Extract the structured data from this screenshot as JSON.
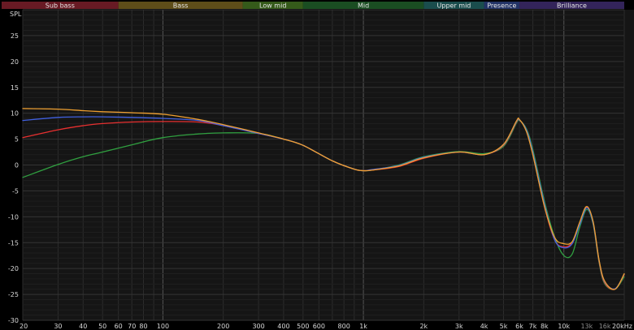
{
  "chart_data": {
    "type": "line",
    "ylabel": "SPL",
    "x_scale": "log",
    "xlim": [
      20,
      20000
    ],
    "ylim": [
      -30,
      30
    ],
    "grid": true,
    "bands": [
      {
        "label": "Sub bass",
        "from": 20,
        "to": 60,
        "color": "#7a1f2a"
      },
      {
        "label": "Bass",
        "from": 60,
        "to": 250,
        "color": "#6e5a1d"
      },
      {
        "label": "Low mid",
        "from": 250,
        "to": 500,
        "color": "#3e6a1f"
      },
      {
        "label": "Mid",
        "from": 500,
        "to": 2000,
        "color": "#1f5a28"
      },
      {
        "label": "Upper mid",
        "from": 2000,
        "to": 4000,
        "color": "#1f5a5a"
      },
      {
        "label": "Presence",
        "from": 4000,
        "to": 6000,
        "color": "#283c78"
      },
      {
        "label": "Brilliance",
        "from": 6000,
        "to": 20000,
        "color": "#3c2a6a"
      }
    ],
    "y_ticks": [
      25,
      20,
      15,
      10,
      5,
      0,
      -5,
      -10,
      -15,
      -20,
      -25,
      -30
    ],
    "x_ticks": [
      {
        "value": 20,
        "label": "20",
        "dim": false
      },
      {
        "value": 30,
        "label": "30",
        "dim": false
      },
      {
        "value": 40,
        "label": "40",
        "dim": false
      },
      {
        "value": 50,
        "label": "50",
        "dim": false
      },
      {
        "value": 60,
        "label": "60",
        "dim": false
      },
      {
        "value": 70,
        "label": "70",
        "dim": false
      },
      {
        "value": 80,
        "label": "80",
        "dim": false
      },
      {
        "value": 100,
        "label": "100",
        "dim": false
      },
      {
        "value": 200,
        "label": "200",
        "dim": false
      },
      {
        "value": 300,
        "label": "300",
        "dim": false
      },
      {
        "value": 400,
        "label": "400",
        "dim": false
      },
      {
        "value": 500,
        "label": "500",
        "dim": false
      },
      {
        "value": 600,
        "label": "600",
        "dim": false
      },
      {
        "value": 800,
        "label": "800",
        "dim": false
      },
      {
        "value": 1000,
        "label": "1k",
        "dim": false
      },
      {
        "value": 2000,
        "label": "2k",
        "dim": false
      },
      {
        "value": 3000,
        "label": "3k",
        "dim": false
      },
      {
        "value": 4000,
        "label": "4k",
        "dim": false
      },
      {
        "value": 5000,
        "label": "5k",
        "dim": false
      },
      {
        "value": 6000,
        "label": "6k",
        "dim": false
      },
      {
        "value": 7000,
        "label": "7k",
        "dim": false
      },
      {
        "value": 8000,
        "label": "8k",
        "dim": false
      },
      {
        "value": 10000,
        "label": "10k",
        "dim": false
      },
      {
        "value": 13000,
        "label": "13k",
        "dim": true
      },
      {
        "value": 16000,
        "label": "16k",
        "dim": true
      },
      {
        "value": 20000,
        "label": "20kHz",
        "dim": false
      }
    ],
    "series": [
      {
        "color": "#f0a030",
        "x": [
          20,
          30,
          40,
          50,
          70,
          100,
          150,
          200,
          300,
          400,
          500,
          700,
          900,
          1000,
          1100,
          1500,
          2000,
          3000,
          4000,
          5000,
          5800,
          6000,
          6500,
          7000,
          8000,
          9000,
          10000,
          11000,
          12000,
          13000,
          14000,
          15000,
          16000,
          18000,
          20000
        ],
        "y": [
          10.9,
          10.8,
          10.5,
          10.3,
          10.1,
          9.8,
          8.8,
          7.8,
          6.2,
          5.0,
          3.8,
          0.8,
          -0.8,
          -1.1,
          -1.0,
          -0.2,
          1.4,
          2.5,
          2.0,
          4.0,
          8.5,
          8.8,
          6.5,
          2.0,
          -8.0,
          -14.0,
          -15.2,
          -14.8,
          -11.0,
          -8.0,
          -11.0,
          -18.5,
          -22.5,
          -24.0,
          -21.0
        ]
      },
      {
        "color": "#e83030",
        "x": [
          20,
          30,
          40,
          50,
          70,
          100,
          150,
          200,
          300,
          400,
          500,
          700,
          900,
          1000,
          1100,
          1500,
          2000,
          3000,
          4000,
          5000,
          5800,
          6000,
          6500,
          7000,
          8000,
          9000,
          10000,
          11000,
          12000,
          13000,
          14000,
          15000,
          16000,
          18000,
          20000
        ],
        "y": [
          5.3,
          6.8,
          7.6,
          8.0,
          8.3,
          8.4,
          8.3,
          7.6,
          6.1,
          5.0,
          3.8,
          0.8,
          -0.8,
          -1.1,
          -1.0,
          -0.3,
          1.3,
          2.5,
          2.0,
          3.8,
          8.3,
          8.7,
          6.7,
          2.3,
          -8.0,
          -14.5,
          -15.8,
          -15.0,
          -11.2,
          -8.2,
          -11.2,
          -18.8,
          -22.8,
          -24.0,
          -21.2
        ]
      },
      {
        "color": "#4060e0",
        "x": [
          20,
          30,
          40,
          50,
          70,
          100,
          150,
          200,
          300,
          400,
          500,
          700,
          900,
          1000,
          1100,
          1500,
          2000,
          3000,
          4000,
          5000,
          5800,
          6000,
          6500,
          7000,
          8000,
          9000,
          10000,
          11000,
          12000,
          13000,
          14000,
          15000,
          16000,
          18000,
          20000
        ],
        "y": [
          8.6,
          9.2,
          9.3,
          9.3,
          9.2,
          9.0,
          8.6,
          7.6,
          6.1,
          5.0,
          3.8,
          0.8,
          -0.8,
          -1.1,
          -0.9,
          -0.1,
          1.5,
          2.5,
          2.0,
          3.9,
          8.4,
          8.7,
          6.8,
          2.5,
          -7.5,
          -14.5,
          -16.0,
          -15.2,
          -11.5,
          -8.3,
          -11.3,
          -18.6,
          -22.6,
          -23.9,
          -21.1
        ]
      },
      {
        "color": "#30a040",
        "x": [
          20,
          30,
          40,
          50,
          70,
          100,
          150,
          200,
          300,
          400,
          500,
          700,
          900,
          1000,
          1100,
          1500,
          2000,
          3000,
          4000,
          5000,
          5800,
          6000,
          6500,
          7000,
          8000,
          9000,
          10000,
          11000,
          12000,
          13000,
          14000,
          15000,
          16000,
          18000,
          20000
        ],
        "y": [
          -2.4,
          0.1,
          1.6,
          2.5,
          3.9,
          5.3,
          6.0,
          6.2,
          6.1,
          5.0,
          3.8,
          0.8,
          -0.8,
          -1.1,
          -1.0,
          0.0,
          1.6,
          2.6,
          2.2,
          3.6,
          8.1,
          8.6,
          7.0,
          3.0,
          -7.0,
          -14.0,
          -17.5,
          -17.2,
          -12.0,
          -8.6,
          -11.5,
          -19.0,
          -23.0,
          -24.0,
          -21.6
        ]
      }
    ]
  }
}
